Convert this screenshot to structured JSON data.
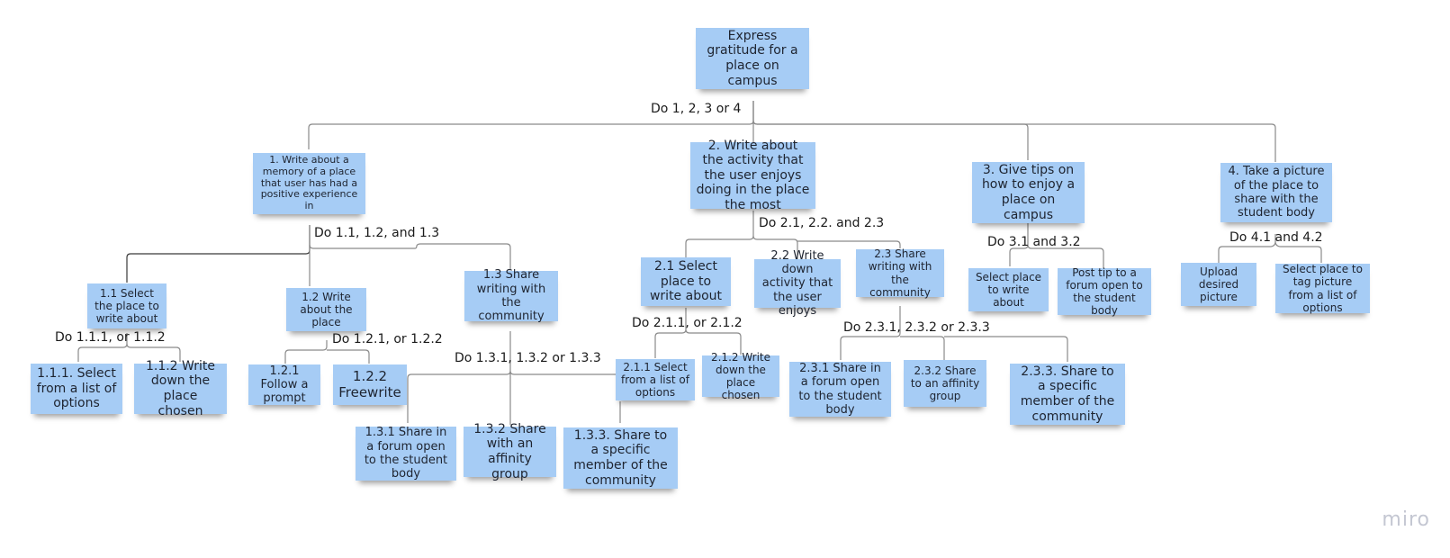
{
  "board": {
    "watermark": "miro",
    "note_color": "#a6ccf5"
  },
  "root": {
    "text": "Express gratitude for a place on campus",
    "branch_label": "Do 1, 2, 3 or 4"
  },
  "goals": [
    {
      "id": "1",
      "text": "1. Write about a memory of a place that user has had a positive experience in",
      "branch_label": "Do 1.1, 1.2, and 1.3",
      "subgoals": [
        {
          "id": "1.1",
          "text": "1.1 Select the place to write about",
          "branch_label": "Do 1.1.1, or 1.1.2",
          "children": [
            {
              "id": "1.1.1",
              "text": "1.1.1. Select from a list of options"
            },
            {
              "id": "1.1.2",
              "text": "1.1.2 Write down the place chosen"
            }
          ]
        },
        {
          "id": "1.2",
          "text": "1.2 Write about the place",
          "branch_label": "Do 1.2.1, or 1.2.2",
          "children": [
            {
              "id": "1.2.1",
              "text": "1.2.1 Follow a prompt"
            },
            {
              "id": "1.2.2",
              "text": "1.2.2 Freewrite"
            }
          ]
        },
        {
          "id": "1.3",
          "text": "1.3 Share writing with the community",
          "branch_label": "Do 1.3.1, 1.3.2 or 1.3.3",
          "children": [
            {
              "id": "1.3.1",
              "text": "1.3.1 Share in a forum open to the student body"
            },
            {
              "id": "1.3.2",
              "text": "1.3.2 Share with an affinity group"
            },
            {
              "id": "1.3.3",
              "text": "1.3.3. Share to a specific member of the community"
            }
          ]
        }
      ]
    },
    {
      "id": "2",
      "text": "2. Write about the activity that the user enjoys doing in the place the most",
      "branch_label": "Do 2.1, 2.2. and 2.3",
      "subgoals": [
        {
          "id": "2.1",
          "text": "2.1 Select place to write about",
          "branch_label": "Do 2.1.1, or 2.1.2",
          "children": [
            {
              "id": "2.1.1",
              "text": "2.1.1 Select from a list of options"
            },
            {
              "id": "2.1.2",
              "text": "2.1.2 Write down the place chosen"
            }
          ]
        },
        {
          "id": "2.2",
          "text": "2.2 Write down activity that the user enjoys"
        },
        {
          "id": "2.3",
          "text": "2.3 Share writing with the community",
          "branch_label": "Do 2.3.1, 2.3.2 or 2.3.3",
          "children": [
            {
              "id": "2.3.1",
              "text": "2.3.1 Share in a forum open to the student body"
            },
            {
              "id": "2.3.2",
              "text": "2.3.2 Share to an affinity group"
            },
            {
              "id": "2.3.3",
              "text": "2.3.3. Share to a specific member of the community"
            }
          ]
        }
      ]
    },
    {
      "id": "3",
      "text": "3. Give tips on how to enjoy a place on campus",
      "branch_label": "Do 3.1 and  3.2",
      "subgoals": [
        {
          "id": "3.1",
          "text": "Select place to write about"
        },
        {
          "id": "3.2",
          "text": "Post tip to a forum open to the student body"
        }
      ]
    },
    {
      "id": "4",
      "text": "4. Take a picture of the place to share with the student body",
      "branch_label": "Do 4.1 and  4.2",
      "subgoals": [
        {
          "id": "4.1",
          "text": "Upload desired picture"
        },
        {
          "id": "4.2",
          "text": "Select place to tag picture from a list of options"
        }
      ]
    }
  ]
}
